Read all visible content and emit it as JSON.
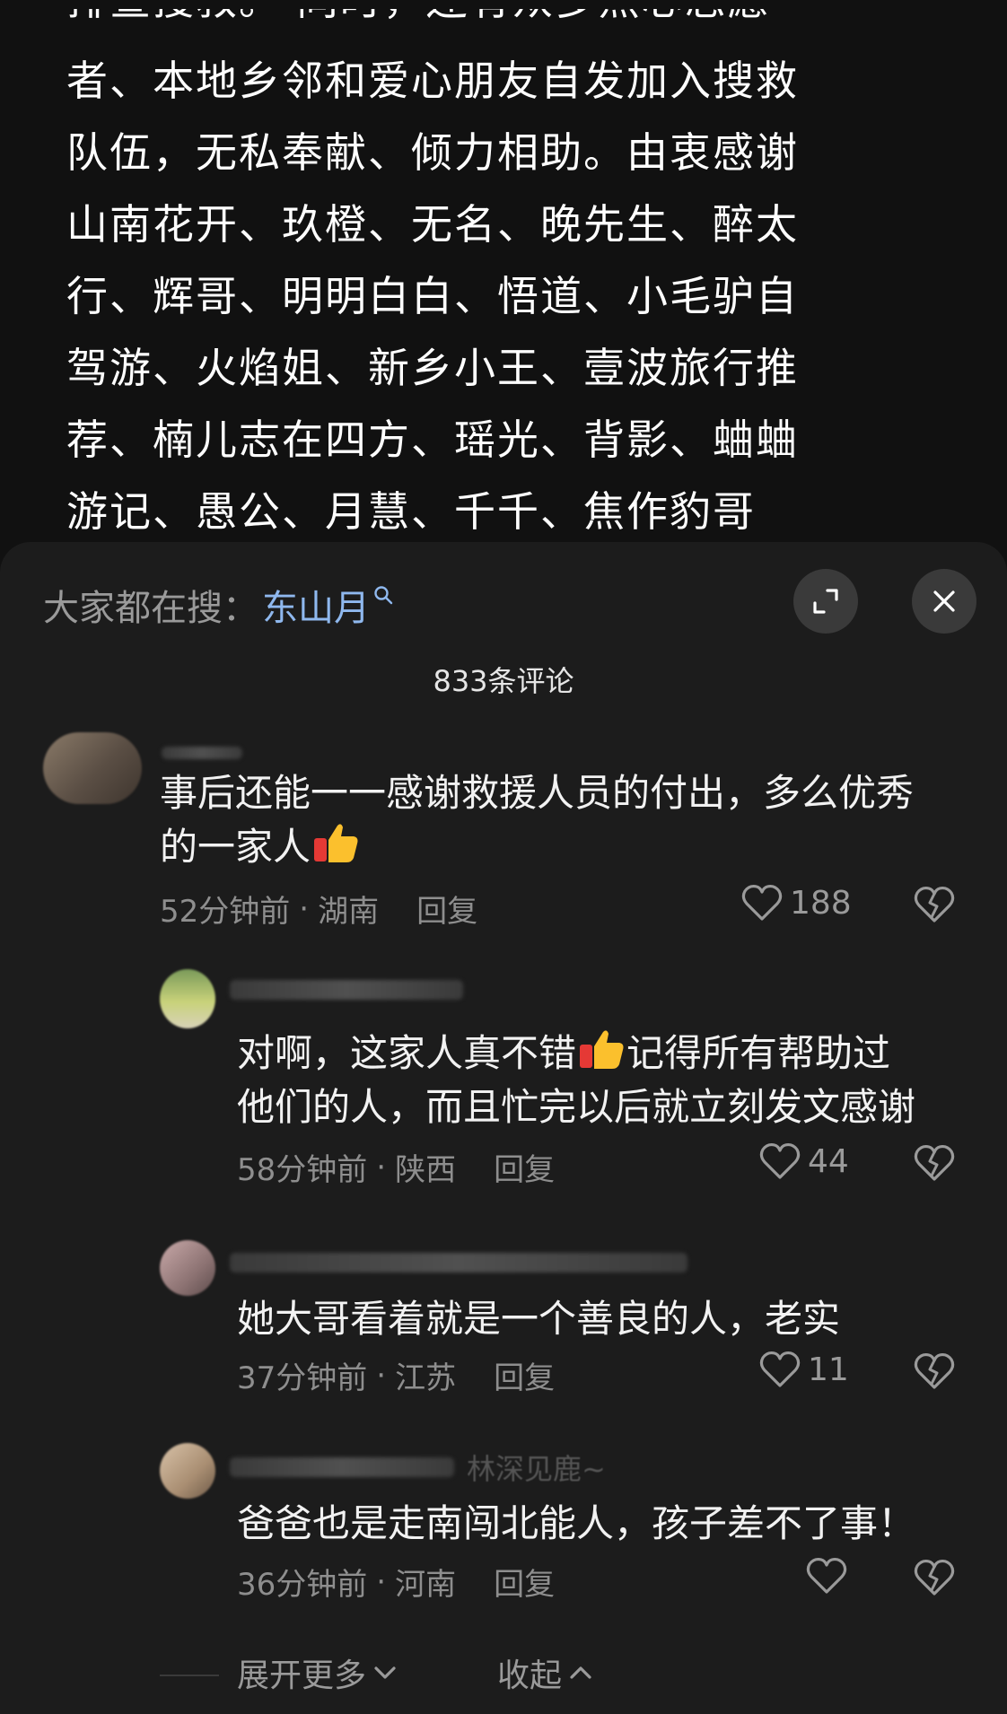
{
  "article": {
    "lines": [
      "排查搜救。 同时，还有众多热心志愿",
      "者、本地乡邻和爱心朋友自发加入搜救",
      "队伍，无私奉献、倾力相助。由衷感谢",
      "山南花开、玖橙、无名、晚先生、醉太",
      "行、辉哥、明明白白、悟道、小毛驴自",
      "驾游、火焰姐、新乡小王、壹波旅行推",
      "荐、楠儿志在四方、瑶光、背影、蛐蛐",
      "游记、愚公、月慧、千千、焦作豹哥"
    ]
  },
  "sheet": {
    "search_label": "大家都在搜：",
    "search_term": "东山月",
    "comment_count": "833条评论"
  },
  "comments": [
    {
      "text_lines": [
        "事后还能一一感谢救援人员的付出，多么优秀",
        "的一家人"
      ],
      "time": "52分钟前",
      "location": "湖南",
      "reply_label": "回复",
      "likes": "188"
    },
    {
      "text_lines": [
        "对啊，这家人真不错",
        "记得所有帮助过",
        "他们的人，而且忙完以后就立刻发文感谢"
      ],
      "time": "58分钟前",
      "location": "陕西",
      "reply_label": "回复",
      "likes": "44"
    },
    {
      "text_lines": [
        "她大哥看着就是一个善良的人，老实"
      ],
      "time": "37分钟前",
      "location": "江苏",
      "reply_label": "回复",
      "likes": "11"
    },
    {
      "name_fragment": "林深见鹿~",
      "text_lines": [
        "爸爸也是走南闯北能人，孩子差不了事！"
      ],
      "time": "36分钟前",
      "location": "河南",
      "reply_label": "回复",
      "likes": ""
    }
  ],
  "footer": {
    "expand_label": "展开更多",
    "collapse_label": "收起"
  },
  "colors": {
    "background": "#161616",
    "sheet": "#1c1c1c",
    "accent_link": "#8fb8ee",
    "muted_text": "#8e8e8e"
  },
  "icons": [
    "search-icon",
    "expand-icon",
    "close-icon",
    "heart-icon",
    "broken-heart-icon",
    "thumbs-up-emoji",
    "chevron-down-icon",
    "chevron-up-icon"
  ]
}
